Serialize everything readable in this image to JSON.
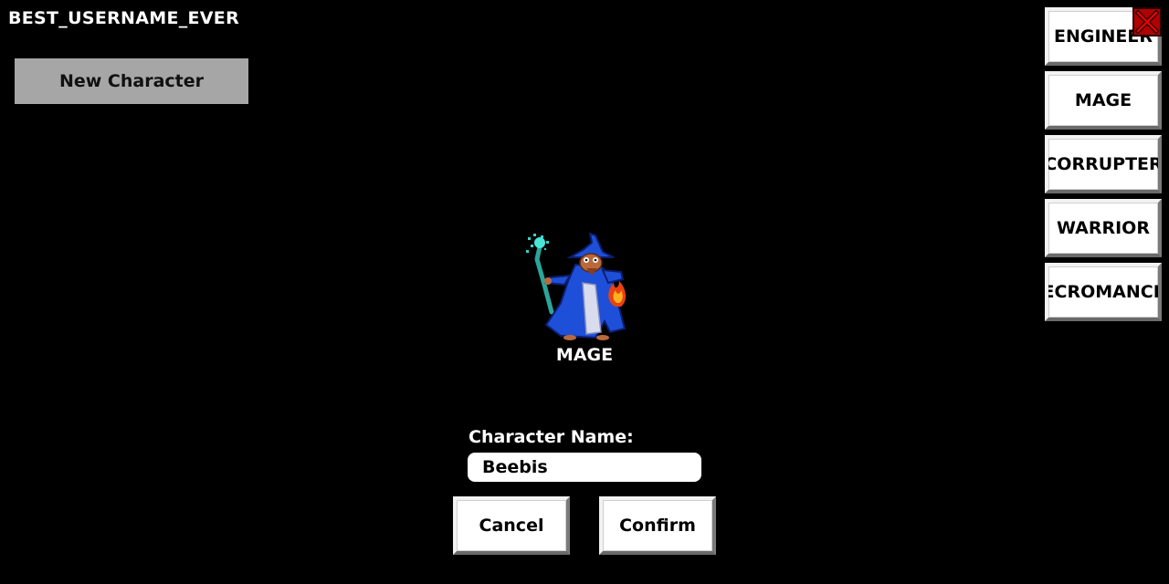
{
  "header": {
    "username": "BEST_USERNAME_EVER"
  },
  "sidebar": {
    "new_character_label": "New Character"
  },
  "class_menu": {
    "items": [
      {
        "label": "ENGINEER"
      },
      {
        "label": "MAGE"
      },
      {
        "label": "CORRUPTER"
      },
      {
        "label": "WARRIOR"
      },
      {
        "label": "NECROMANCER"
      }
    ],
    "close_icon": "close-x-icon"
  },
  "preview": {
    "selected_class": "MAGE",
    "sprite_icon": "mage-character-sprite"
  },
  "form": {
    "name_label": "Character Name:",
    "name_value": "Beebis",
    "cancel_label": "Cancel",
    "confirm_label": "Confirm"
  },
  "colors": {
    "background": "#000000",
    "button_face": "#ffffff",
    "selected_panel": "#a6a6a6",
    "close_button": "#b00000",
    "mage_robe": "#1e4fd8"
  }
}
